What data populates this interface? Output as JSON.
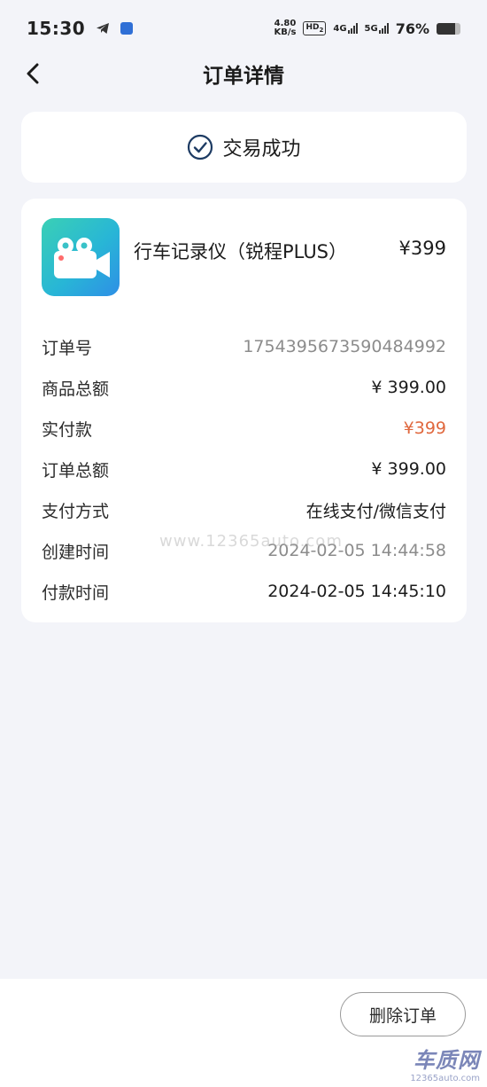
{
  "status_bar": {
    "time": "15:30",
    "net_speed_value": "4.80",
    "net_speed_unit": "KB/s",
    "hd_label": "HD",
    "hd_sub": "2",
    "sim1_label": "4G",
    "sim2_label": "5G",
    "battery_percent": "76%",
    "battery_level": 0.76,
    "icons": [
      "telegram-icon",
      "app-notification-icon",
      "hd-icon",
      "signal-icon",
      "battery-icon"
    ]
  },
  "header": {
    "title": "订单详情",
    "back_icon": "chevron-left-icon"
  },
  "status_card": {
    "text": "交易成功",
    "icon": "check-circle-icon",
    "accent": "#1d3b63"
  },
  "product": {
    "name": "行车记录仪（锐程PLUS）",
    "price": "¥399",
    "icon": "video-camera-icon"
  },
  "order_info": [
    {
      "label": "订单号",
      "value": "1754395673590484992",
      "style": "muted"
    },
    {
      "label": "商品总额",
      "value": "¥ 399.00",
      "style": "normal"
    },
    {
      "label": "实付款",
      "value": "¥399",
      "style": "accent"
    },
    {
      "label": "订单总额",
      "value": "¥ 399.00",
      "style": "normal"
    },
    {
      "label": "支付方式",
      "value": "在线支付/微信支付",
      "style": "normal"
    },
    {
      "label": "创建时间",
      "value": "2024-02-05 14:44:58",
      "style": "muted"
    },
    {
      "label": "付款时间",
      "value": "2024-02-05 14:45:10",
      "style": "normal"
    }
  ],
  "watermark_text": "www.12365auto.com",
  "bottom": {
    "delete_label": "删除订单"
  },
  "brand_watermark": {
    "big": "车质网",
    "small": "12365auto.com"
  },
  "colors": {
    "background": "#f3f4f9",
    "accent_price": "#e0683e",
    "muted_text": "#8c8c8c"
  }
}
